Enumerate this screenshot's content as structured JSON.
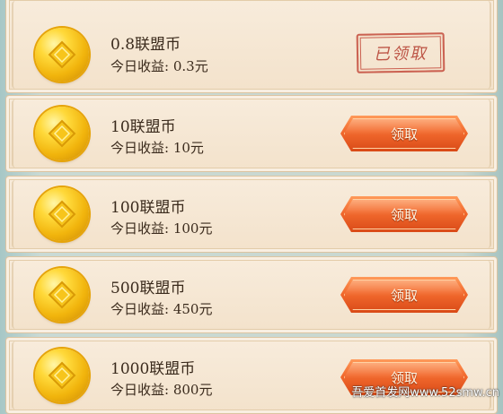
{
  "rows": [
    {
      "reward": "0.8联盟币",
      "earnings_label": "今日收益:",
      "earnings_value": "0.3元",
      "claimed": true
    },
    {
      "reward": "10联盟币",
      "earnings_label": "今日收益:",
      "earnings_value": "10元",
      "claimed": false
    },
    {
      "reward": "100联盟币",
      "earnings_label": "今日收益:",
      "earnings_value": "100元",
      "claimed": false
    },
    {
      "reward": "500联盟币",
      "earnings_label": "今日收益:",
      "earnings_value": "450元",
      "claimed": false
    },
    {
      "reward": "1000联盟币",
      "earnings_label": "今日收益:",
      "earnings_value": "800元",
      "claimed": false
    }
  ],
  "buttons": {
    "claim_label": "领取",
    "claimed_label": "已领取"
  },
  "watermark": "吾爱首发网www.52smw.cn",
  "colors": {
    "button": "#f26a2e",
    "stamp": "#c44b3c",
    "coin": "#f1b40c"
  }
}
